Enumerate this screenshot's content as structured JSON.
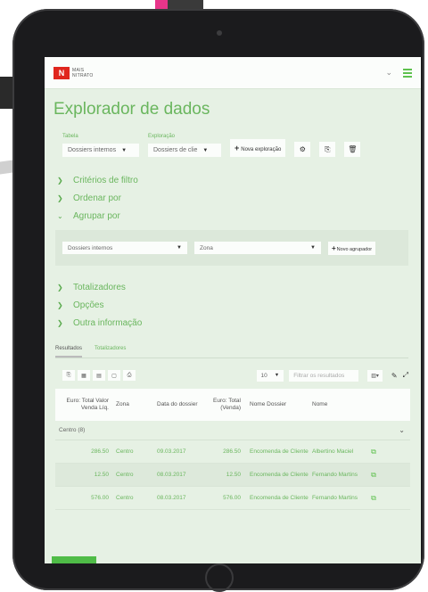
{
  "app": {
    "brand": "MAIS NITRATO",
    "brand_mark": "N"
  },
  "header": {
    "chevron": "⌄"
  },
  "page": {
    "title": "Explorador de dados"
  },
  "controls": {
    "tabela_label": "Tabela",
    "tabela_value": "Dossiers internos",
    "exploracao_label": "Exploração",
    "exploracao_value": "Dossiers de clie",
    "new_exploration": "Nova exploração"
  },
  "sections": [
    {
      "label": "Critérios de filtro",
      "expanded": false
    },
    {
      "label": "Ordenar por",
      "expanded": false
    },
    {
      "label": "Agrupar por",
      "expanded": true
    },
    {
      "label": "Totalizadores",
      "expanded": false
    },
    {
      "label": "Opções",
      "expanded": false
    },
    {
      "label": "Outra informação",
      "expanded": false
    }
  ],
  "group_by": {
    "table": "Dossiers internos",
    "field": "Zona",
    "new_button": "Novo agrupador"
  },
  "tabs": {
    "results": "Resultados",
    "totals": "Totalizadores"
  },
  "table_controls": {
    "per_page": "10",
    "filter_placeholder": "Filtrar os resultados"
  },
  "table": {
    "headers": [
      "Euro: Total Valor Venda Líq.",
      "Zona",
      "Data do dossier",
      "Euro: Total (Venda)",
      "Nome Dossier",
      "Nome"
    ],
    "group_label": "Centro (8)",
    "rows": [
      {
        "valor": "286.50",
        "zona": "Centro",
        "data": "09.03.2017",
        "total": "286.50",
        "dossier": "Encomenda de Cliente",
        "nome": "Albertino Maciel"
      },
      {
        "valor": "12.50",
        "zona": "Centro",
        "data": "08.03.2017",
        "total": "12.50",
        "dossier": "Encomenda de Cliente",
        "nome": "Fernando Martins"
      },
      {
        "valor": "576.00",
        "zona": "Centro",
        "data": "08.03.2017",
        "total": "576.00",
        "dossier": "Encomenda de Cliente",
        "nome": "Fernando Martins"
      }
    ]
  },
  "colors": {
    "accent": "#6ab65e",
    "screen_bg": "#e6f1e4",
    "brand_red": "#e0261d",
    "button_green": "#4fbc47"
  }
}
